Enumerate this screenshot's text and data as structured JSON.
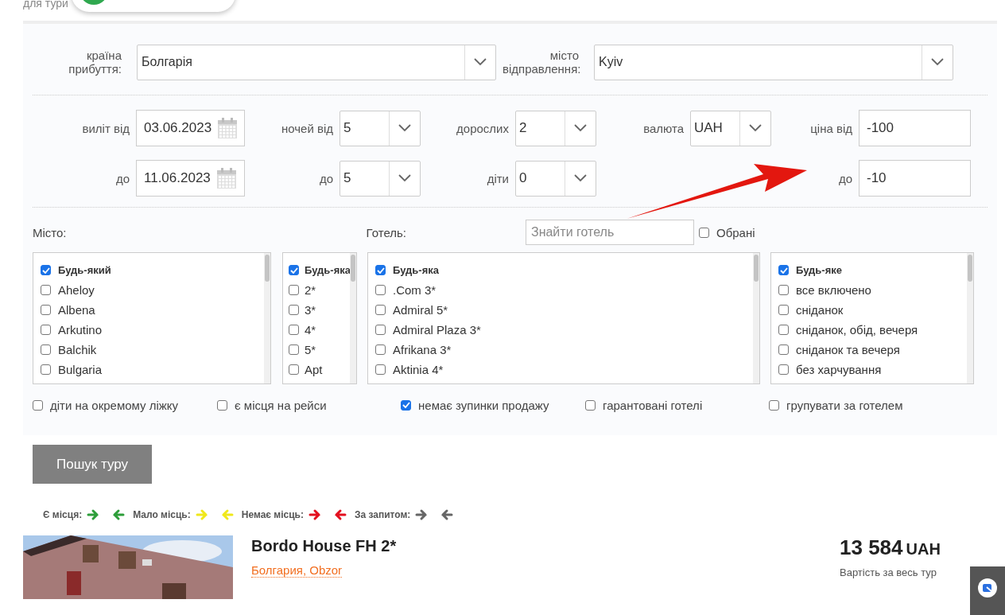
{
  "header": {
    "partial_text": "для тури"
  },
  "destination": [
    {
      "label": "країна прибуття:",
      "value": "Болгарія"
    },
    {
      "label": "місто відправлення:",
      "value": "Kyiv"
    }
  ],
  "params": [
    {
      "items": [
        {
          "label": "виліт від",
          "value": "03.06.2023",
          "kind": "date"
        },
        {
          "label": "до",
          "value": "11.06.2023",
          "kind": "date"
        }
      ]
    },
    {
      "items": [
        {
          "label": "ночей від",
          "value": "5",
          "kind": "select"
        },
        {
          "label": "до",
          "value": "5",
          "kind": "select"
        }
      ]
    },
    {
      "items": [
        {
          "label": "дорослих",
          "value": "2",
          "kind": "select"
        },
        {
          "label": "діти",
          "value": "0",
          "kind": "select"
        }
      ]
    },
    {
      "items": [
        {
          "label": "валюта",
          "value": "UAH",
          "kind": "select"
        }
      ]
    },
    {
      "items": [
        {
          "label": "ціна від",
          "value": "-100",
          "kind": "text"
        },
        {
          "label": "до",
          "value": "-10",
          "kind": "text"
        }
      ]
    }
  ],
  "city_label": "Місто:",
  "hotel_label": "Готель:",
  "hotel_search": {
    "placeholder": "Знайти готель"
  },
  "favorites": {
    "label": "Обрані",
    "checked": false
  },
  "lists": [
    {
      "kind": "city",
      "items": [
        {
          "label": "Будь-який",
          "kind": "any",
          "checked": true
        },
        {
          "label": "Aheloy",
          "kind": "option",
          "checked": false
        },
        {
          "label": "Albena",
          "kind": "option",
          "checked": false
        },
        {
          "label": "Arkutino",
          "kind": "option",
          "checked": false
        },
        {
          "label": "Balchik",
          "kind": "option",
          "checked": false
        },
        {
          "label": "Bulgaria",
          "kind": "option",
          "checked": false
        }
      ]
    },
    {
      "kind": "stars",
      "items": [
        {
          "label": "Будь-яка",
          "kind": "any",
          "checked": true
        },
        {
          "label": "2*",
          "kind": "option",
          "checked": false
        },
        {
          "label": "3*",
          "kind": "option",
          "checked": false
        },
        {
          "label": "4*",
          "kind": "option",
          "checked": false
        },
        {
          "label": "5*",
          "kind": "option",
          "checked": false
        },
        {
          "label": "Apt",
          "kind": "option",
          "checked": false
        }
      ]
    },
    {
      "kind": "hotel",
      "items": [
        {
          "label": "Будь-яка",
          "kind": "any",
          "checked": true
        },
        {
          "label": ".Com 3*",
          "kind": "option",
          "checked": false
        },
        {
          "label": "Admiral 5*",
          "kind": "option",
          "checked": false
        },
        {
          "label": "Admiral Plaza 3*",
          "kind": "option",
          "checked": false
        },
        {
          "label": "Afrikana 3*",
          "kind": "option",
          "checked": false
        },
        {
          "label": "Aktinia 4*",
          "kind": "option",
          "checked": false
        }
      ]
    },
    {
      "kind": "meal",
      "items": [
        {
          "label": "Будь-яке",
          "kind": "any",
          "checked": true
        },
        {
          "label": "все включено",
          "kind": "option",
          "checked": false
        },
        {
          "label": "сніданок",
          "kind": "option",
          "checked": false
        },
        {
          "label": "сніданок, обід, вечеря",
          "kind": "option",
          "checked": false
        },
        {
          "label": "сніданок та вечеря",
          "kind": "option",
          "checked": false
        },
        {
          "label": "без харчування",
          "kind": "option",
          "checked": false
        }
      ]
    }
  ],
  "options": [
    {
      "label": "діти на окремому ліжку",
      "checked": false
    },
    {
      "label": "є місця на рейси",
      "checked": false
    },
    {
      "label": "немає зупинки продажу",
      "checked": true
    },
    {
      "label": "гарантовані готелі",
      "checked": false
    },
    {
      "label": "групувати за готелем",
      "checked": false
    }
  ],
  "search_button": "Пошук туру",
  "legend": [
    {
      "label": "Є місця:",
      "color": "#2e9e3a"
    },
    {
      "label": "Мало місць:",
      "color": "#f0e81a"
    },
    {
      "label": "Немає місць:",
      "color": "#e3101f"
    },
    {
      "label": "За запитом:",
      "color": "#666666"
    }
  ],
  "result": {
    "title": "Bordo House FH 2*",
    "location": "Болгария, Obzor",
    "price": "13 584",
    "currency": "UAH",
    "price_note": "Вартість за весь тур"
  }
}
